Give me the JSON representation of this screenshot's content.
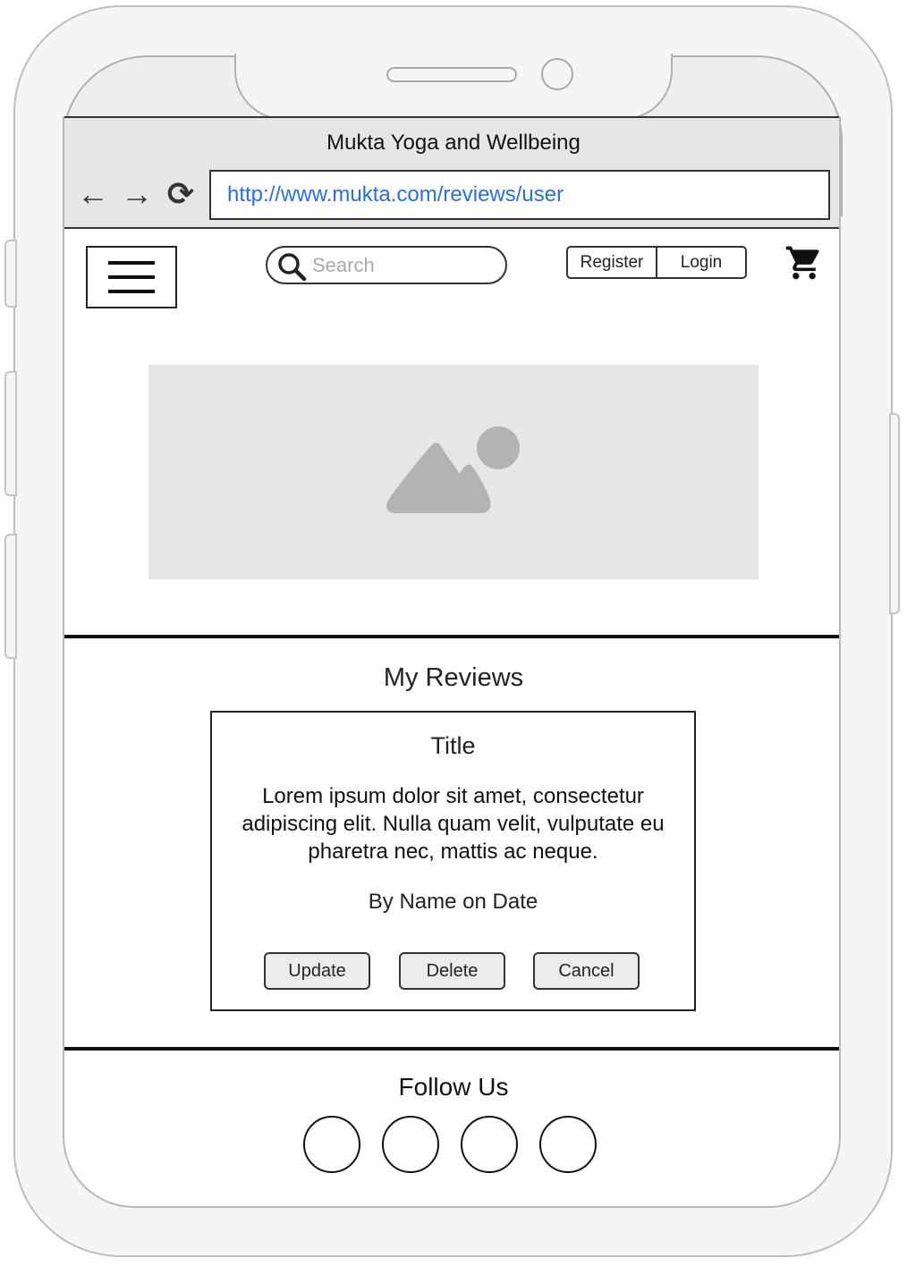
{
  "browser": {
    "page_title": "Mukta Yoga and Wellbeing",
    "back_icon": "←",
    "forward_icon": "→",
    "reload_icon": "⟳",
    "url": "http://www.mukta.com/reviews/user"
  },
  "header": {
    "search_placeholder": "Search",
    "register_label": "Register",
    "login_label": "Login"
  },
  "reviews": {
    "heading": "My Reviews",
    "card": {
      "title": "Title",
      "body": "Lorem ipsum dolor sit amet, consectetur adipiscing elit. Nulla quam velit, vulputate eu pharetra nec, mattis ac neque.",
      "byline": "By Name on Date",
      "update_label": "Update",
      "delete_label": "Delete",
      "cancel_label": "Cancel"
    }
  },
  "footer": {
    "heading": "Follow Us",
    "social_links": [
      "social-link",
      "social-link",
      "social-link",
      "social-link"
    ]
  },
  "colors": {
    "url_text": "#2b6fd6",
    "browser_bar": "#e6e6e6",
    "image_placeholder": "#e6e6e6",
    "image_icon": "#b3b3b3"
  }
}
